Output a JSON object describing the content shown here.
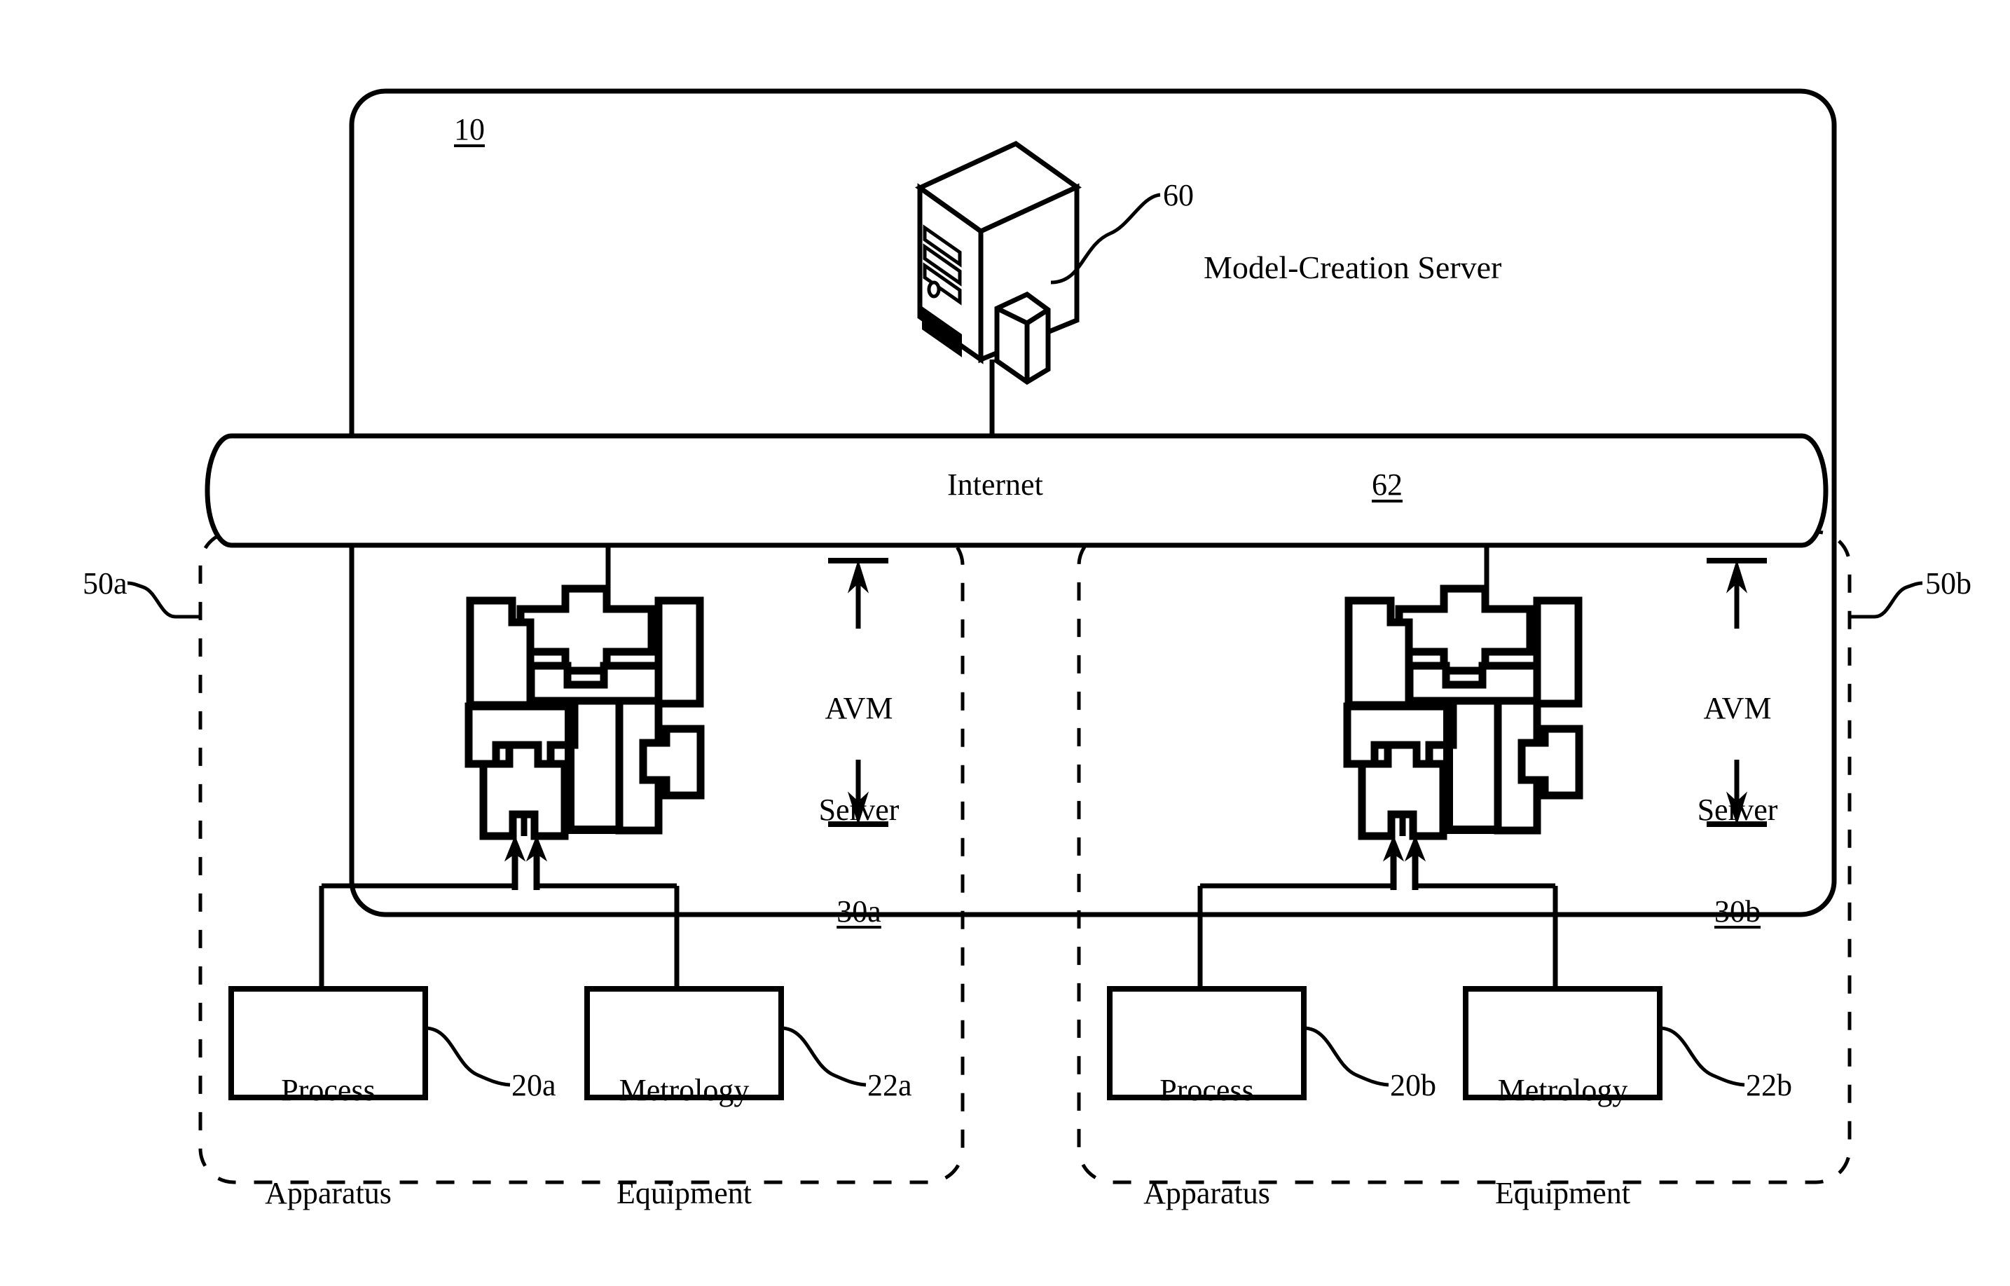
{
  "figure": {
    "system_ref": "10",
    "network": {
      "name": "Internet",
      "ref": "62"
    },
    "model_creation_server": {
      "label": "Model-Creation Server",
      "ref": "60",
      "icon": "tower-server-icon"
    },
    "fabs": [
      {
        "id": "fab-a",
        "ref": "50a",
        "avm_server": {
          "name_line1": "AVM",
          "name_line2": "Server",
          "ref": "30a"
        },
        "process_apparatus": {
          "line1": "Process",
          "line2": "Apparatus",
          "ref": "20a"
        },
        "metrology_equipment": {
          "line1": "Metrology",
          "line2": "Equipment",
          "ref": "22a"
        }
      },
      {
        "id": "fab-b",
        "ref": "50b",
        "avm_server": {
          "name_line1": "AVM",
          "name_line2": "Server",
          "ref": "30b"
        },
        "process_apparatus": {
          "line1": "Process",
          "line2": "Apparatus",
          "ref": "20b"
        },
        "metrology_equipment": {
          "line1": "Metrology",
          "line2": "Equipment",
          "ref": "22b"
        }
      }
    ],
    "colors": {
      "line": "#000000",
      "background": "#ffffff"
    }
  }
}
